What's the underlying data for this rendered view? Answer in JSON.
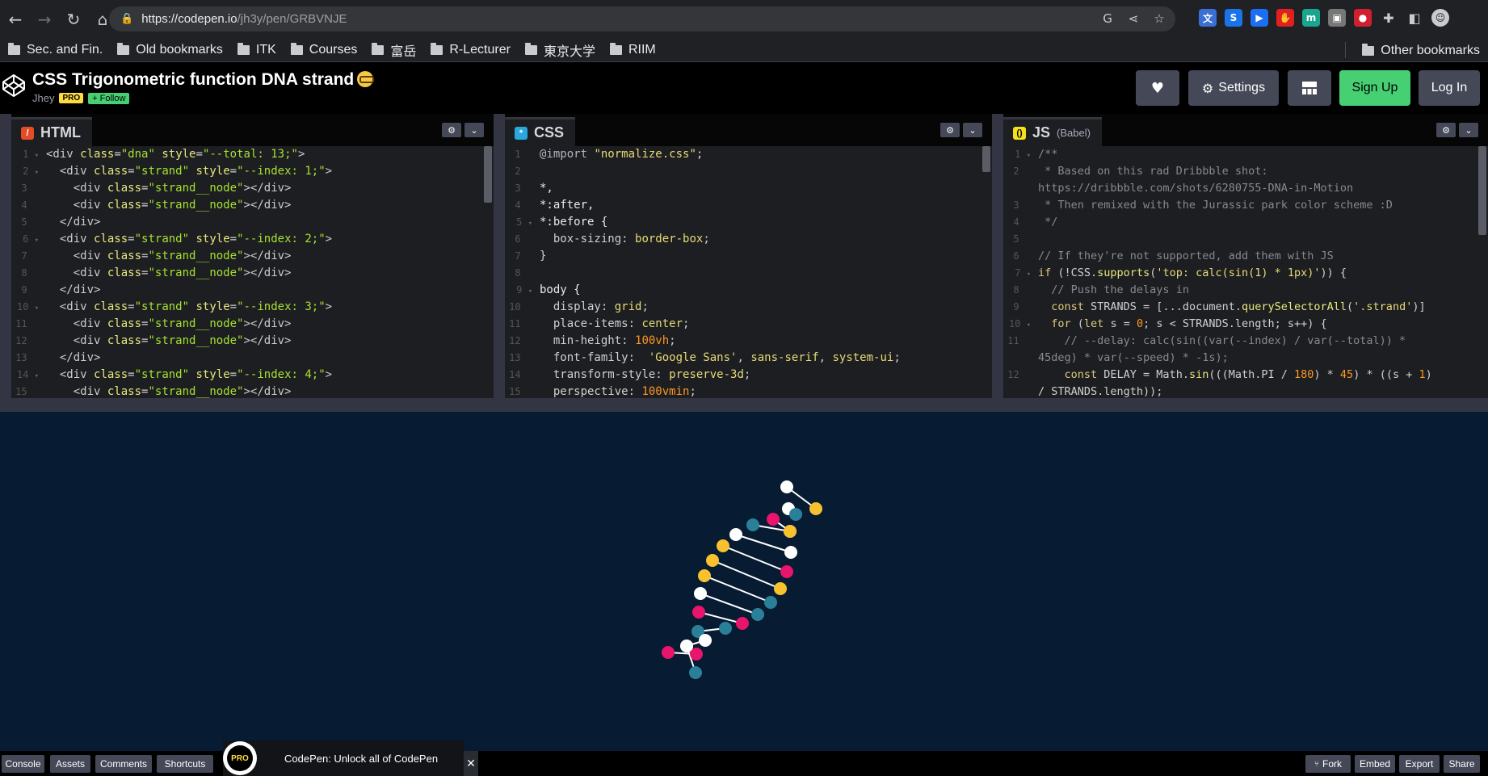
{
  "browser": {
    "url_host": "https://codepen.io",
    "url_path": "/jh3y/pen/GRBVNJE",
    "bookmarks": [
      "Sec. and Fin.",
      "Old bookmarks",
      "ITK",
      "Courses",
      "富岳",
      "R-Lecturer",
      "東京大学",
      "RIIM"
    ],
    "other_bookmarks": "Other bookmarks"
  },
  "header": {
    "title": "CSS Trigonometric function DNA strand",
    "author": "Jhey",
    "pro": "PRO",
    "follow": "+ Follow",
    "settings": "Settings",
    "signup": "Sign Up",
    "login": "Log In"
  },
  "editors": {
    "html": {
      "label": "HTML"
    },
    "css": {
      "label": "CSS"
    },
    "js": {
      "label": "JS",
      "sub": "(Babel)"
    }
  },
  "footer": {
    "console": "Console",
    "assets": "Assets",
    "comments": "Comments",
    "shortcuts": "Shortcuts",
    "promo_badge": "PRO",
    "promo_text": "CodePen: Unlock all of CodePen",
    "fork": "Fork",
    "embed": "Embed",
    "export": "Export",
    "share": "Share"
  },
  "colors": {
    "white": "#ffffff",
    "pink": "#e9146c",
    "yellow": "#f7c22d",
    "teal": "#2a8099",
    "bg": "#071b33"
  }
}
